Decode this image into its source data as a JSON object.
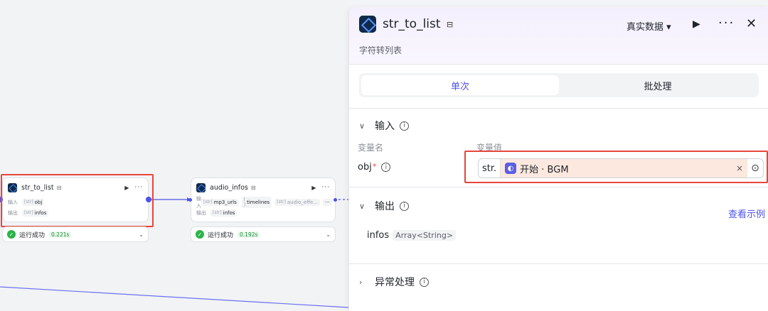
{
  "canvas": {
    "node1": {
      "title": "str_to_list",
      "tag_icon": "save-icon",
      "input_label": "输入",
      "output_label": "输出",
      "input_pill_type": "[str]",
      "input_pill": "obj",
      "output_pill_type": "[str]",
      "output_pill": "infos",
      "status_text": "运行成功",
      "status_time": "0.221s"
    },
    "node2": {
      "title": "audio_infos",
      "tag_icon": "save-icon",
      "input_label": "输入",
      "output_label": "输出",
      "input_pills": [
        {
          "type": "[str]",
          "name": "mp3_urls"
        },
        {
          "type": "[ ]",
          "name": "timelines"
        },
        {
          "type": "[str]",
          "name": "audio_effe..."
        }
      ],
      "overflow": "···",
      "output_pill_type": "[str]",
      "output_pill": "infos",
      "status_text": "运行成功",
      "status_time": "0.192s"
    }
  },
  "panel": {
    "title": "str_to_list",
    "description": "字符转列表",
    "data_mode": "真实数据 ▾",
    "tabs": [
      "单次",
      "批处理"
    ],
    "input_section": {
      "title": "输入",
      "col_name": "变量名",
      "col_value": "变量值",
      "var_name": "obj",
      "required_mark": "*",
      "value_type": "str.",
      "value_ref": "开始 · BGM",
      "clear": "×"
    },
    "output_section": {
      "title": "输出",
      "link": "查看示例",
      "var_name": "infos",
      "var_type": "Array<String>"
    },
    "error_section": {
      "title": "异常处理"
    }
  },
  "colors": {
    "accent": "#4d53e8",
    "highlight_box": "#e8453c",
    "success": "#28b446",
    "ref_bg": "#fce8de"
  }
}
